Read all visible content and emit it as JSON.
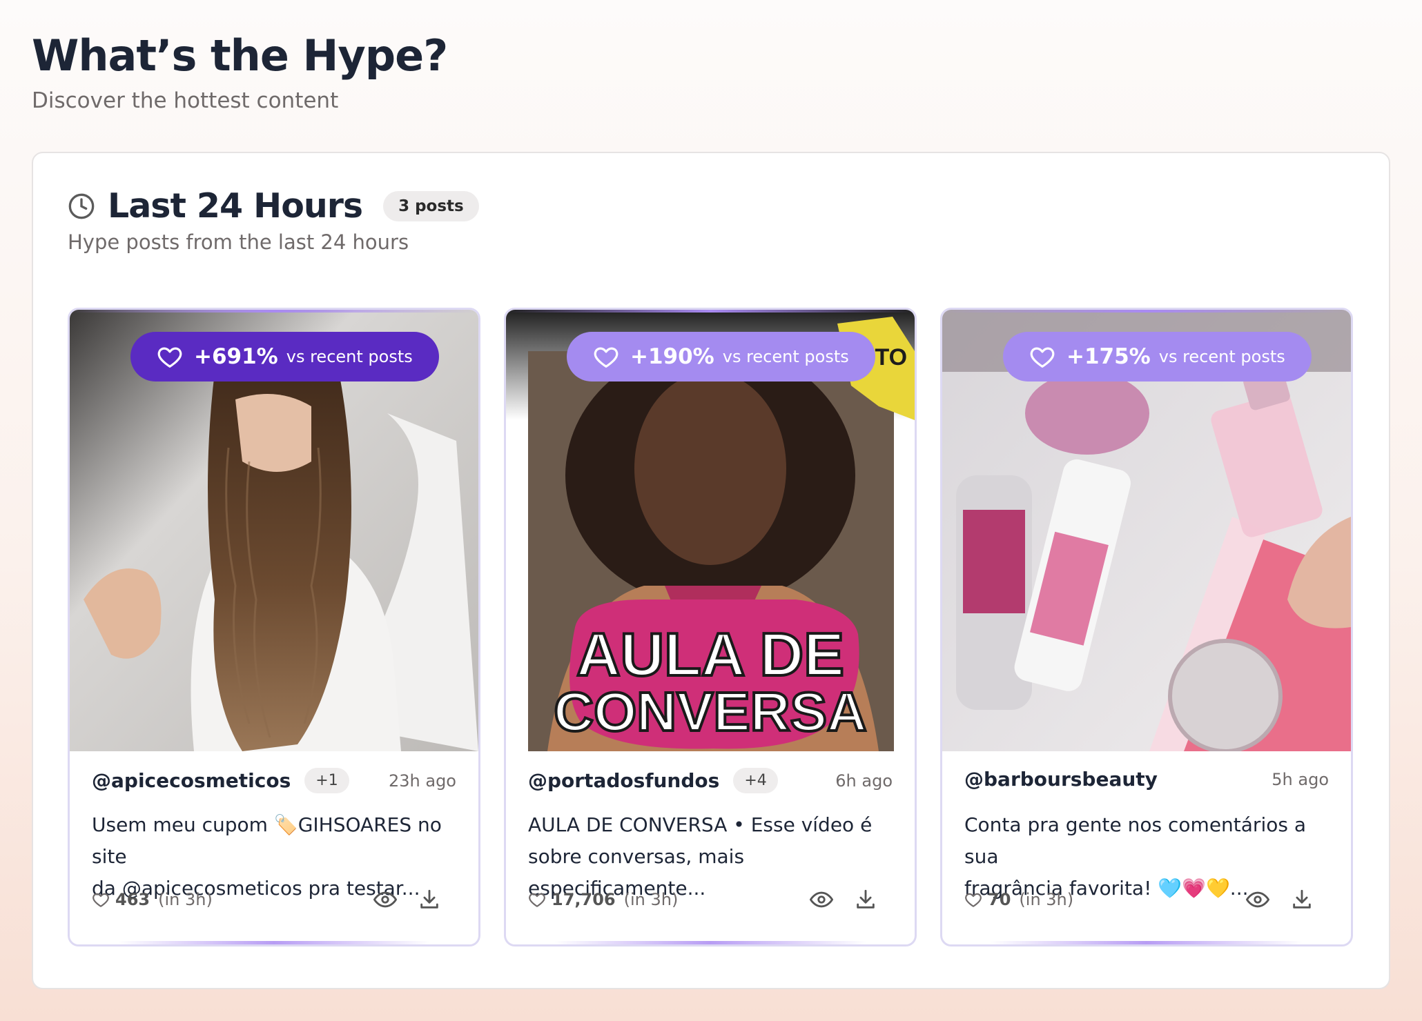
{
  "page": {
    "title": "What’s the Hype?",
    "subtitle": "Discover the hottest content"
  },
  "section": {
    "icon": "clock-icon",
    "title": "Last 24 Hours",
    "count_badge": "3 posts",
    "subtitle": "Hype posts from the last 24 hours"
  },
  "colors": {
    "hype_badge_strong": "#5a2bc2",
    "hype_badge_light": "#a48bf0",
    "card_border": "#ddd9f3",
    "title_text": "#1d2536",
    "muted_text": "#6f6a6a"
  },
  "posts": [
    {
      "hype_pct": "+691%",
      "hype_vs": "vs recent posts",
      "handle": "@apicecosmeticos",
      "collab_badge": "+1",
      "time_ago": "23h ago",
      "caption_line1": "Usem meu cupom 🏷️GIHSOARES no site",
      "caption_line2": "da @apicecosmeticos pra testar...",
      "likes": "463",
      "likes_window": "(in 3h)"
    },
    {
      "hype_pct": "+190%",
      "hype_vs": "vs recent posts",
      "handle": "@portadosfundos",
      "collab_badge": "+4",
      "time_ago": "6h ago",
      "caption_line1": "AULA DE CONVERSA • Esse vídeo é",
      "caption_line2": "sobre conversas, mais especificamente...",
      "likes": "17,706",
      "likes_window": "(in 3h)",
      "thumb_text_line1": "AULA DE",
      "thumb_text_line2": "CONVERSA",
      "thumb_sticker": "ITO"
    },
    {
      "hype_pct": "+175%",
      "hype_vs": "vs recent posts",
      "handle": "@barboursbeauty",
      "time_ago": "5h ago",
      "caption_line1": "Conta pra gente nos comentários a sua",
      "caption_line2": "fragrância favorita! 🩵💗💛...",
      "likes": "70",
      "likes_window": "(in 3h)"
    }
  ]
}
